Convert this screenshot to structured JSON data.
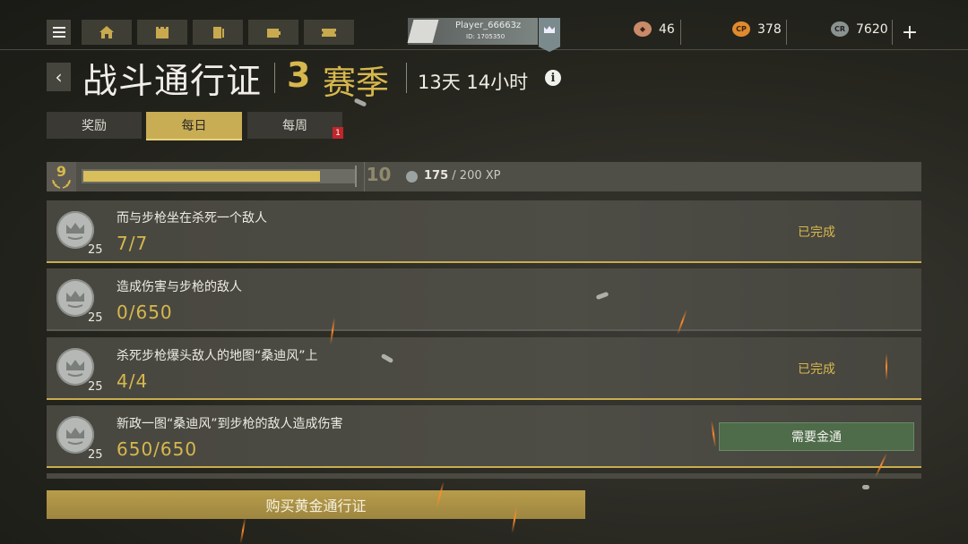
{
  "topbar": {
    "player_name": "Player_66663z",
    "player_id": "ID: 1705350",
    "currencies": [
      {
        "icon": "crate-icon",
        "value": "46",
        "color": "#c98a6a"
      },
      {
        "icon": "cod-points-icon",
        "value": "378",
        "color": "#e08a2e"
      },
      {
        "icon": "credits-icon",
        "value": "7620",
        "color": "#8b9391"
      }
    ],
    "plus": "+"
  },
  "header": {
    "title": "战斗通行证",
    "season_number": "3",
    "season_label": "赛季",
    "time_left": "13天 14小时",
    "info": "i"
  },
  "tabs": [
    {
      "label": "奖励",
      "active": false
    },
    {
      "label": "每日",
      "active": true
    },
    {
      "label": "每周",
      "active": false,
      "badge": "1"
    }
  ],
  "progress": {
    "current_level": "9",
    "next_level": "10",
    "xp_current": "175",
    "xp_total": "/ 200 XP",
    "fill_fraction": 0.875
  },
  "challenges": [
    {
      "text": "而与步枪坐在杀死一个敌人",
      "progress": "7/7",
      "reward": "25",
      "status": "已完成"
    },
    {
      "text": "造成伤害与步枪的敌人",
      "progress": "0/650",
      "reward": "25",
      "status": ""
    },
    {
      "text": "杀死步枪爆头敌人的地图“桑迪风”上",
      "progress": "4/4",
      "reward": "25",
      "status": "已完成"
    },
    {
      "text": "新政一图“桑迪风”到步枪的敌人造成伤害",
      "progress": "650/650",
      "reward": "25",
      "status": "需要金通"
    }
  ],
  "buy_button": "购买黄金通行证",
  "colors": {
    "gold": "#d7b84d",
    "tab_active": "#c9ad55",
    "green_button": "#4e6b4a"
  }
}
